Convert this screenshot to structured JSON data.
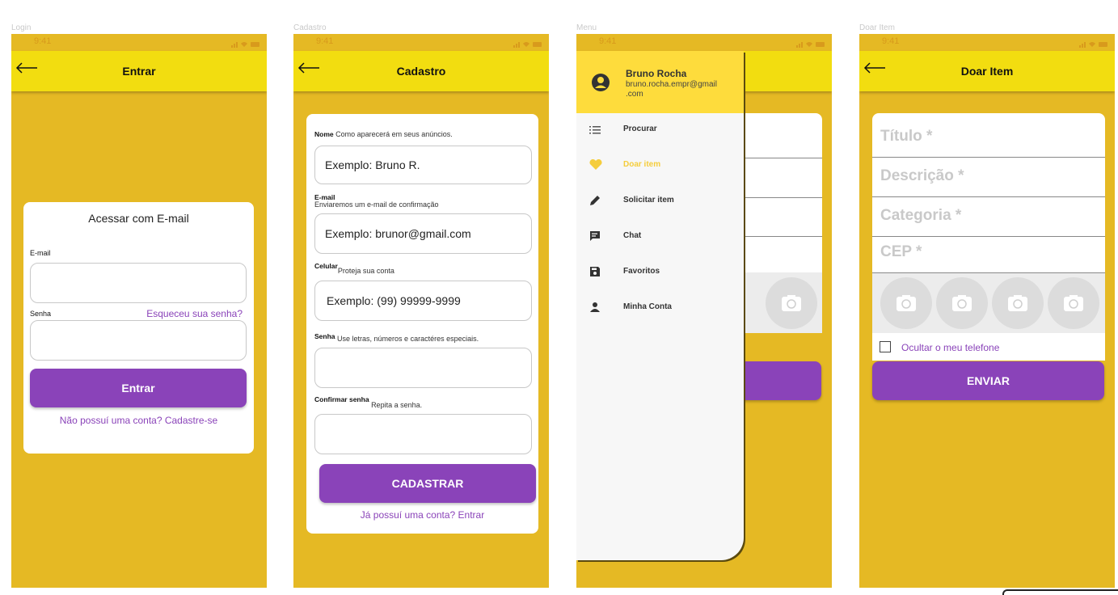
{
  "status": {
    "time": "9:41"
  },
  "frames": {
    "login": {
      "label": "Login",
      "title": "Entrar",
      "card_title": "Acessar com E-mail",
      "email_label": "E-mail",
      "password_label": "Senha",
      "forgot_link": "Esqueceu sua senha?",
      "submit_label": "Entrar",
      "signup_link": "Não possuí uma conta? Cadastre-se"
    },
    "cadastro": {
      "label": "Cadastro",
      "title": "Cadastro",
      "fields": [
        {
          "label": "Nome",
          "hint": "Como aparecerá em seus anúncios.",
          "placeholder": "Exemplo: Bruno R."
        },
        {
          "label": "E-mail",
          "hint": "Enviaremos um e-mail de confirmação",
          "placeholder": "Exemplo: brunor@gmail.com"
        },
        {
          "label": "Celular",
          "hint": "Proteja sua conta",
          "placeholder": "Exemplo: (99) 99999-9999"
        },
        {
          "label": "Senha",
          "hint": "Use letras, números e caractéres especiais.",
          "placeholder": ""
        },
        {
          "label": "Confirmar senha",
          "hint": "Repita a senha.",
          "placeholder": ""
        }
      ],
      "submit_label": "CADASTRAR",
      "login_link": "Já possuí uma conta? Entrar"
    },
    "menu": {
      "label": "Menu",
      "user_name": "Bruno Rocha",
      "user_email_line1": "bruno.rocha.empr@gmail",
      "user_email_line2": ".com",
      "items": [
        {
          "label": "Procurar",
          "icon": "list-icon",
          "active": false
        },
        {
          "label": "Doar item",
          "icon": "heart-icon",
          "active": true
        },
        {
          "label": "Solicitar item",
          "icon": "pencil-icon",
          "active": false
        },
        {
          "label": "Chat",
          "icon": "chat-icon",
          "active": false
        },
        {
          "label": "Favoritos",
          "icon": "save-icon",
          "active": false
        },
        {
          "label": "Minha Conta",
          "icon": "person-icon",
          "active": false
        }
      ]
    },
    "doar": {
      "label": "Doar Item",
      "title": "Doar Item",
      "fields": [
        "Título *",
        "Descrição *",
        "Categoria *",
        "CEP *"
      ],
      "hide_phone_label": "Ocultar o meu telefone",
      "hide_phone_checked": false,
      "submit_label": "ENVIAR"
    }
  },
  "colors": {
    "background": "#e5b924",
    "appbar": "#f2dd10",
    "accent": "#8a43b9",
    "drawer_header": "#fedc3c",
    "active_item": "#f5cd3c"
  }
}
